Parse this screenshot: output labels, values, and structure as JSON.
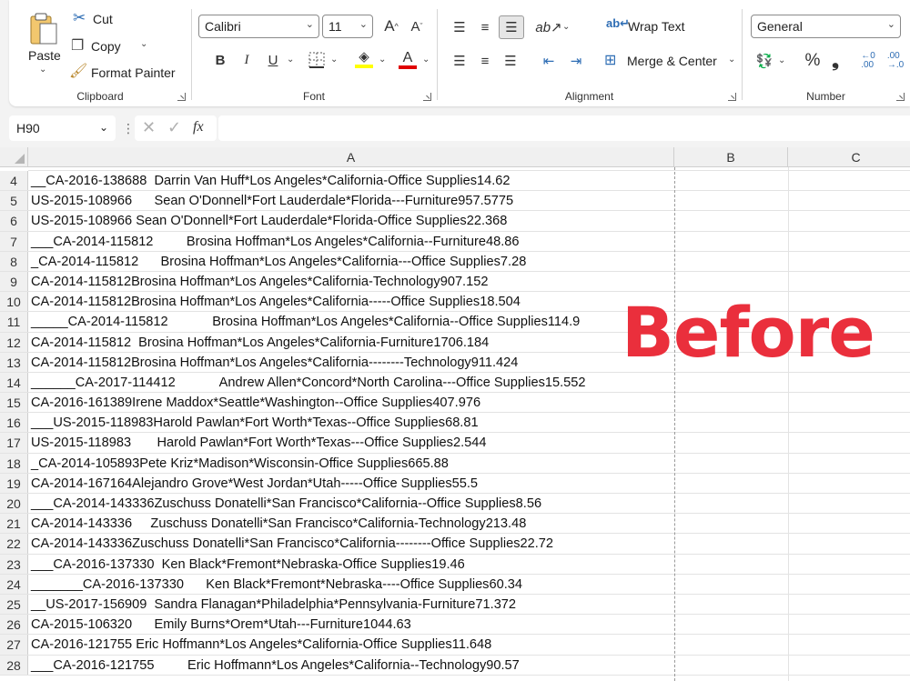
{
  "ribbon": {
    "clipboard": {
      "label": "Clipboard",
      "paste": "Paste",
      "cut": "Cut",
      "copy": "Copy",
      "format_painter": "Format Painter"
    },
    "font": {
      "label": "Font",
      "name": "Calibri",
      "size": "11"
    },
    "alignment": {
      "label": "Alignment",
      "wrap_text": "Wrap Text",
      "merge_center": "Merge & Center"
    },
    "number": {
      "label": "Number",
      "format": "General"
    }
  },
  "formula_bar": {
    "name_box": "H90",
    "fx": "fx",
    "value": ""
  },
  "columns": [
    "A",
    "B",
    "C"
  ],
  "rows": [
    {
      "n": "4",
      "a": "__CA-2016-138688  Darrin Van Huff*Los Angeles*California-Office Supplies14.62"
    },
    {
      "n": "5",
      "a": "US-2015-108966      Sean O'Donnell*Fort Lauderdale*Florida---Furniture957.5775"
    },
    {
      "n": "6",
      "a": "US-2015-108966 Sean O'Donnell*Fort Lauderdale*Florida-Office Supplies22.368"
    },
    {
      "n": "7",
      "a": "___CA-2014-115812         Brosina Hoffman*Los Angeles*California--Furniture48.86"
    },
    {
      "n": "8",
      "a": "_CA-2014-115812      Brosina Hoffman*Los Angeles*California---Office Supplies7.28"
    },
    {
      "n": "9",
      "a": "CA-2014-115812Brosina Hoffman*Los Angeles*California-Technology907.152"
    },
    {
      "n": "10",
      "a": "CA-2014-115812Brosina Hoffman*Los Angeles*California-----Office Supplies18.504"
    },
    {
      "n": "11",
      "a": "_____CA-2014-115812            Brosina Hoffman*Los Angeles*California--Office Supplies114.9"
    },
    {
      "n": "12",
      "a": "CA-2014-115812  Brosina Hoffman*Los Angeles*California-Furniture1706.184"
    },
    {
      "n": "13",
      "a": "CA-2014-115812Brosina Hoffman*Los Angeles*California--------Technology911.424"
    },
    {
      "n": "14",
      "a": "______CA-2017-114412            Andrew Allen*Concord*North Carolina---Office Supplies15.552"
    },
    {
      "n": "15",
      "a": "CA-2016-161389Irene Maddox*Seattle*Washington--Office Supplies407.976"
    },
    {
      "n": "16",
      "a": "___US-2015-118983Harold Pawlan*Fort Worth*Texas--Office Supplies68.81"
    },
    {
      "n": "17",
      "a": "US-2015-118983       Harold Pawlan*Fort Worth*Texas---Office Supplies2.544"
    },
    {
      "n": "18",
      "a": "_CA-2014-105893Pete Kriz*Madison*Wisconsin-Office Supplies665.88"
    },
    {
      "n": "19",
      "a": "CA-2014-167164Alejandro Grove*West Jordan*Utah-----Office Supplies55.5"
    },
    {
      "n": "20",
      "a": "___CA-2014-143336Zuschuss Donatelli*San Francisco*California--Office Supplies8.56"
    },
    {
      "n": "21",
      "a": "CA-2014-143336     Zuschuss Donatelli*San Francisco*California-Technology213.48"
    },
    {
      "n": "22",
      "a": "CA-2014-143336Zuschuss Donatelli*San Francisco*California--------Office Supplies22.72"
    },
    {
      "n": "23",
      "a": "___CA-2016-137330  Ken Black*Fremont*Nebraska-Office Supplies19.46"
    },
    {
      "n": "24",
      "a": "_______CA-2016-137330      Ken Black*Fremont*Nebraska----Office Supplies60.34"
    },
    {
      "n": "25",
      "a": "__US-2017-156909  Sandra Flanagan*Philadelphia*Pennsylvania-Furniture71.372"
    },
    {
      "n": "26",
      "a": "CA-2015-106320      Emily Burns*Orem*Utah---Furniture1044.63"
    },
    {
      "n": "27",
      "a": "CA-2016-121755 Eric Hoffmann*Los Angeles*California-Office Supplies11.648"
    },
    {
      "n": "28",
      "a": "___CA-2016-121755         Eric Hoffmann*Los Angeles*California--Technology90.57"
    }
  ],
  "overlay_text": "Before",
  "colors": {
    "overlay": "#ea2f3c",
    "font_highlight": "#ffff00",
    "font_color": "#e00000"
  }
}
